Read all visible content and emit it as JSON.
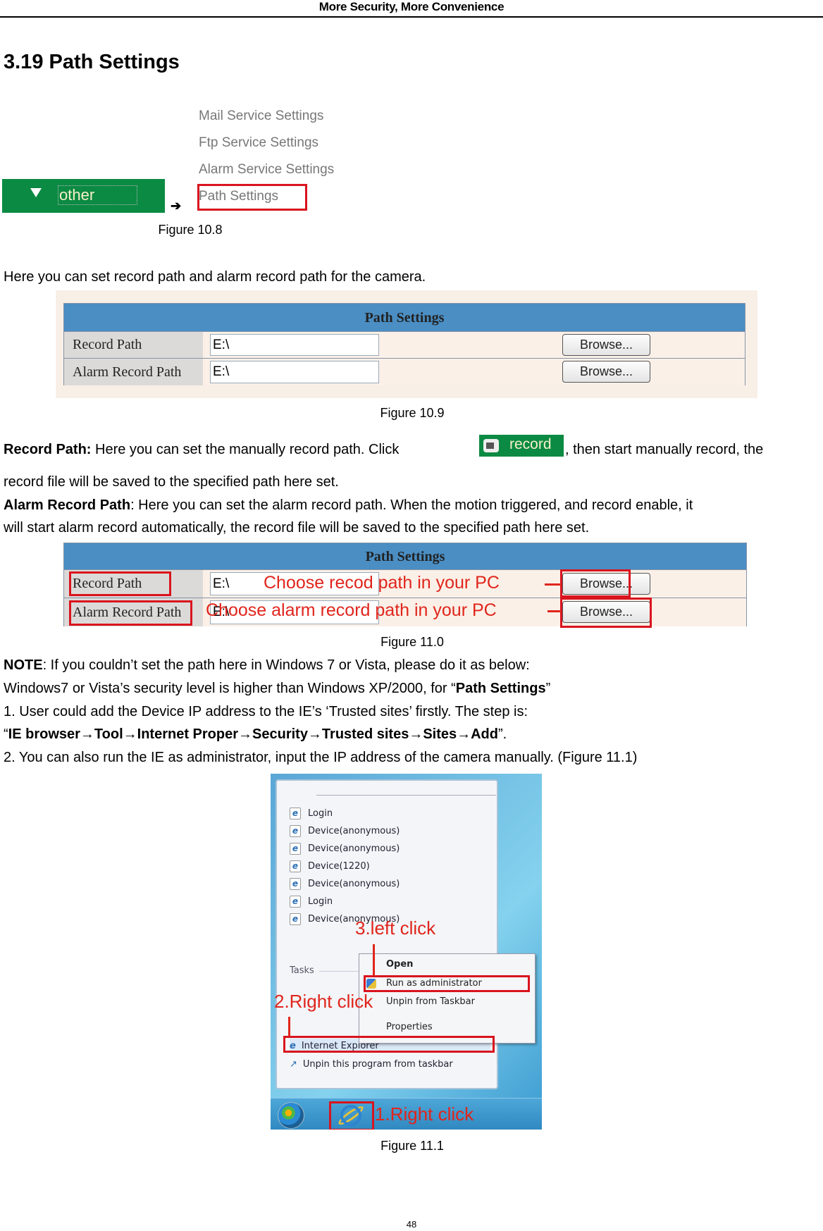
{
  "header": {
    "running_title": "More Security, More Convenience"
  },
  "section": {
    "title": "3.19 Path Settings"
  },
  "figure_10_8": {
    "nav_group_label": "other",
    "arrow": "➔",
    "menu_items": [
      "Mail Service Settings",
      "Ftp Service Settings",
      "Alarm Service Settings",
      "Path Settings"
    ],
    "highlighted_item": "Path Settings",
    "caption": "Figure 10.8"
  },
  "intro_text": "Here you can set record path and alarm record path for the camera.",
  "figure_10_9": {
    "table_title": "Path Settings",
    "rows": [
      {
        "label": "Record Path",
        "value": "E:\\",
        "button": "Browse..."
      },
      {
        "label": "Alarm Record Path",
        "value": "E:\\",
        "button": "Browse..."
      }
    ],
    "caption": "Figure 10.9"
  },
  "record_path_desc": {
    "term": "Record Path:",
    "text_before": " Here you can set the manually record path. Click",
    "button_label": "record",
    "text_after": ", then start manually record, the",
    "line2": "record file will be saved to the specified path here set."
  },
  "alarm_path_desc": {
    "term": "Alarm Record Path",
    "line1": ": Here you can set the alarm record path. When the motion triggered, and record enable, it",
    "line2": "will start alarm record automatically, the record file will be saved to the specified path here set."
  },
  "figure_11_0": {
    "table_title": "Path Settings",
    "rows": [
      {
        "label": "Record Path",
        "value": "E:\\",
        "button": "Browse...",
        "annotation": "Choose recod path in your PC"
      },
      {
        "label": "Alarm Record Path",
        "value": "E:\\",
        "button": "Browse...",
        "annotation": "Choose alarm record path in your PC"
      }
    ],
    "caption": "Figure 11.0"
  },
  "note": {
    "term": "NOTE",
    "line1": ": If you couldn’t set the path here in Windows 7 or Vista, please do it as below:",
    "line2_before": "Windows7 or Vista’s security level is higher than Windows XP/2000, for “",
    "line2_bold": "Path Settings",
    "line2_after": "”",
    "line3": "1. User could add the Device IP address to the IE’s ‘Trusted sites’ firstly. The step is:",
    "line4_open": "“",
    "line4_bold": "IE browser→Tool→Internet Proper→Security→Trusted sites→Sites→Add",
    "line4_close": "”.",
    "line5": "2. You can also run the IE as administrator, input the IP address of the camera manually. (Figure 11.1)"
  },
  "figure_11_1": {
    "jump_list": [
      "Login",
      "Device(anonymous)",
      "Device(anonymous)",
      "Device(1220)",
      "Device(anonymous)",
      "Login",
      "Device(anonymous)"
    ],
    "tasks_label": "Tasks",
    "context_menu": [
      "Open",
      "Run as administrator",
      "Unpin from Taskbar",
      "Properties"
    ],
    "pinned_items": [
      "Internet Explorer",
      "Unpin this program from taskbar"
    ],
    "annotations": {
      "step1": "1.Right click",
      "step2": "2.Right click",
      "step3": "3.left click"
    },
    "caption": "Figure 11.1"
  },
  "footer": {
    "page_number": "48"
  },
  "colors": {
    "accent_green": "#0b8a43",
    "table_header_blue": "#4a8ec4",
    "annotation_red": "#e0251c"
  }
}
